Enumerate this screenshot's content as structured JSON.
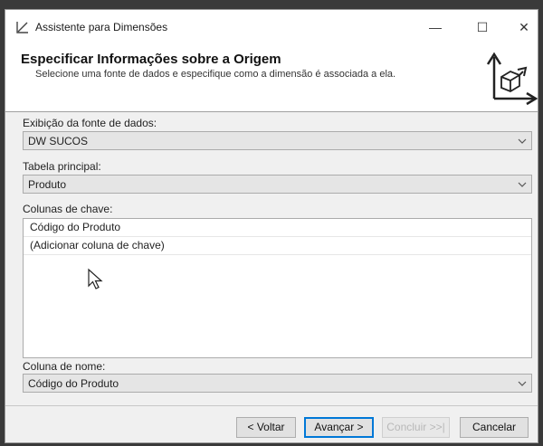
{
  "window": {
    "title": "Assistente para Dimensões",
    "minimize_glyph": "—",
    "maximize_glyph": "☐",
    "close_glyph": "✕"
  },
  "header": {
    "title": "Especificar Informações sobre a Origem",
    "subtitle": "Selecione uma fonte de dados e especifique como a dimensão é associada a ela."
  },
  "form": {
    "datasource_label": "Exibição da fonte de dados:",
    "datasource_value": "DW SUCOS",
    "main_table_label": "Tabela principal:",
    "main_table_value": "Produto",
    "key_columns_label": "Colunas de chave:",
    "key_columns": [
      "Código do Produto",
      "(Adicionar coluna de chave)"
    ],
    "name_column_label": "Coluna de nome:",
    "name_column_value": "Código do Produto"
  },
  "footer": {
    "back_label": "< Voltar",
    "next_label": "Avançar >",
    "finish_label": "Concluir >>|",
    "cancel_label": "Cancelar"
  },
  "icons": {
    "app": "dimension-wizard-icon",
    "header_art": "3d-axes-cube-icon",
    "dropdown": "chevron-down-icon",
    "cursor": "mouse-pointer-icon"
  }
}
